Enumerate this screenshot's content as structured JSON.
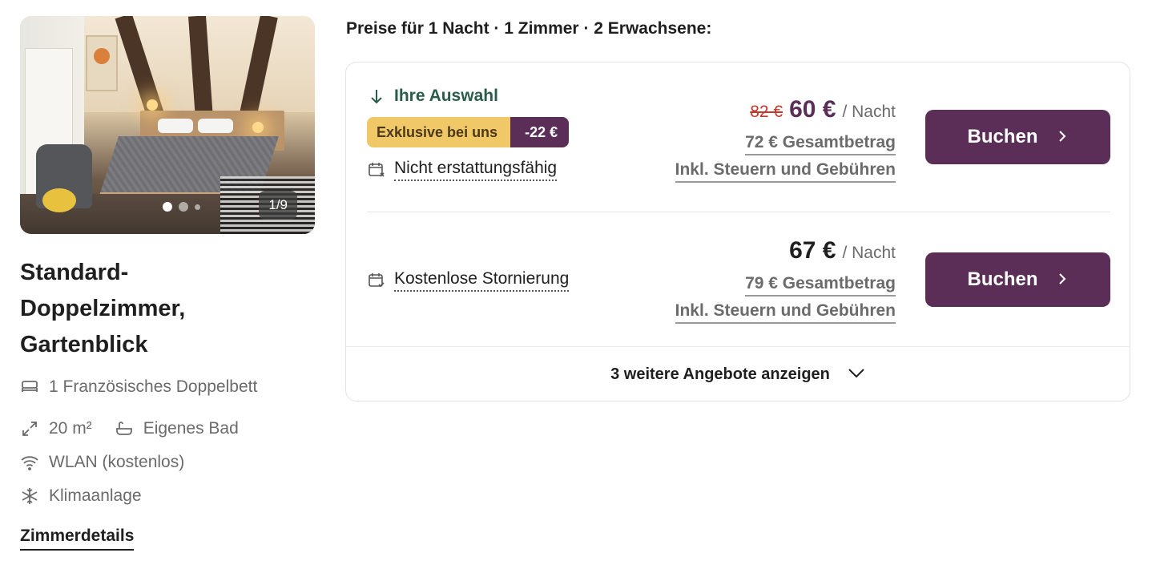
{
  "room": {
    "photo_counter": "1/9",
    "title": "Standard-Doppelzimmer, Gartenblick",
    "features": {
      "bed": "1 Französisches Doppelbett",
      "size": "20 m²",
      "bath": "Eigenes Bad",
      "wifi": "WLAN (kostenlos)",
      "ac": "Klimaanlage"
    },
    "details_link": "Zimmerdetails"
  },
  "prices_header": "Preise für 1 Nacht · 1 Zimmer · 2 Erwachsene:",
  "offers": [
    {
      "selection_label": "Ihre Auswahl",
      "badge_exclusive": "Exklusive bei uns",
      "badge_discount": "-22 €",
      "policy": "Nicht erstattungsfähig",
      "old_price": "82 €",
      "price": "60 €",
      "per_night": "/ Nacht",
      "total": "72 € Gesamtbetrag",
      "taxes": "Inkl. Steuern und Gebühren",
      "button": "Buchen"
    },
    {
      "policy": "Kostenlose Stornierung",
      "price": "67 €",
      "per_night": "/ Nacht",
      "total": "79 € Gesamtbetrag",
      "taxes": "Inkl. Steuern und Gebühren",
      "button": "Buchen"
    }
  ],
  "more_offers": "3 weitere Angebote anzeigen",
  "colors": {
    "primary": "#5a2e57",
    "badge_yellow": "#f1c868",
    "selection_green": "#2a5c4a",
    "old_price_red": "#c0392b"
  }
}
